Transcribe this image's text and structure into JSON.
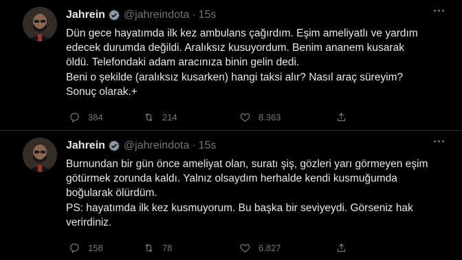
{
  "tweets": [
    {
      "name": "Jahrein",
      "handle": "@jahreindota",
      "dot": "·",
      "time": "15s",
      "lines": [
        "Dün gece hayatımda ilk kez ambulans çağırdım. Eşim ameliyatlı ve yardım",
        "edecek durumda değildi. Aralıksız kusuyordum. Benim ananem kusarak",
        "öldü. Telefondaki adam aracınıza binin gelin dedi.",
        "Beni o şekilde (aralıksız kusarken) hangi taksi alır? Nasıl araç süreyim?",
        "Sonuç olarak.+"
      ],
      "replies": "384",
      "retweets": "214",
      "likes": "8.363"
    },
    {
      "name": "Jahrein",
      "handle": "@jahreindota",
      "dot": "·",
      "time": "15s",
      "lines": [
        "Burnundan bir gün önce ameliyat olan, suratı şiş, gözleri yarı görmeyen eşim",
        "götürmek zorunda kaldı. Yalnız olsaydım herhalde kendi kusmuğumda",
        "boğularak ölürdüm.",
        "PS: hayatımda ilk kez kusmuyorum. Bu başka bir seviyeydi. Görseniz hak",
        "verirdiniz."
      ],
      "replies": "158",
      "retweets": "78",
      "likes": "6.827"
    }
  ],
  "icons": {
    "verified": "verified-badge-icon",
    "more": "more-options-icon",
    "reply": "reply-icon",
    "retweet": "retweet-icon",
    "like": "like-heart-icon"
  },
  "colors": {
    "background": "#000000",
    "text": "#e7e9ea",
    "muted": "#71767b",
    "divider": "#2f3336"
  }
}
